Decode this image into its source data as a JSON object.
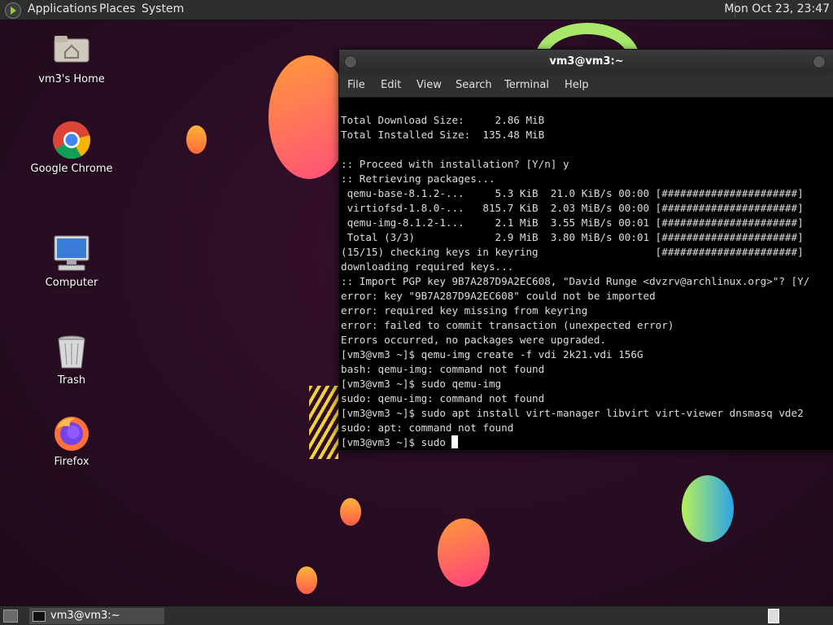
{
  "top_panel": {
    "menus": [
      "Applications",
      "Places",
      "System"
    ],
    "clock": "Mon Oct 23, 23:47"
  },
  "desktop_icons": [
    {
      "label": "vm3's Home",
      "icon": "home-folder-icon"
    },
    {
      "label": "Google Chrome",
      "icon": "chrome-icon"
    },
    {
      "label": "Computer",
      "icon": "computer-icon"
    },
    {
      "label": "Trash",
      "icon": "trash-icon"
    },
    {
      "label": "Firefox",
      "icon": "firefox-icon"
    }
  ],
  "terminal": {
    "title": "vm3@vm3:~",
    "menu": [
      "File",
      "Edit",
      "View",
      "Search",
      "Terminal",
      "Help"
    ],
    "lines": [
      "Total Download Size:     2.86 MiB",
      "Total Installed Size:  135.48 MiB",
      "",
      ":: Proceed with installation? [Y/n] y",
      ":: Retrieving packages...",
      " qemu-base-8.1.2-...     5.3 KiB  21.0 KiB/s 00:00 [######################]",
      " virtiofsd-1.8.0-...   815.7 KiB  2.03 MiB/s 00:00 [######################]",
      " qemu-img-8.1.2-1...     2.1 MiB  3.55 MiB/s 00:01 [######################]",
      " Total (3/3)             2.9 MiB  3.80 MiB/s 00:01 [######################]",
      "(15/15) checking keys in keyring                   [######################]",
      "downloading required keys...",
      ":: Import PGP key 9B7A287D9A2EC608, \"David Runge <dvzrv@archlinux.org>\"? [Y/",
      "error: key \"9B7A287D9A2EC608\" could not be imported",
      "error: required key missing from keyring",
      "error: failed to commit transaction (unexpected error)",
      "Errors occurred, no packages were upgraded.",
      "[vm3@vm3 ~]$ qemu-img create -f vdi 2k21.vdi 156G",
      "bash: qemu-img: command not found",
      "[vm3@vm3 ~]$ sudo qemu-img",
      "sudo: qemu-img: command not found",
      "[vm3@vm3 ~]$ sudo apt install virt-manager libvirt virt-viewer dnsmasq vde2",
      "sudo: apt: command not found"
    ],
    "prompt_line": "[vm3@vm3 ~]$ sudo "
  },
  "taskbar": {
    "window_label": "vm3@vm3:~"
  },
  "colors": {
    "panel": "#2e2e2e",
    "terminal_bg": "#000000",
    "terminal_fg": "#dddddd",
    "desktop_bg": "#2b0d25"
  }
}
